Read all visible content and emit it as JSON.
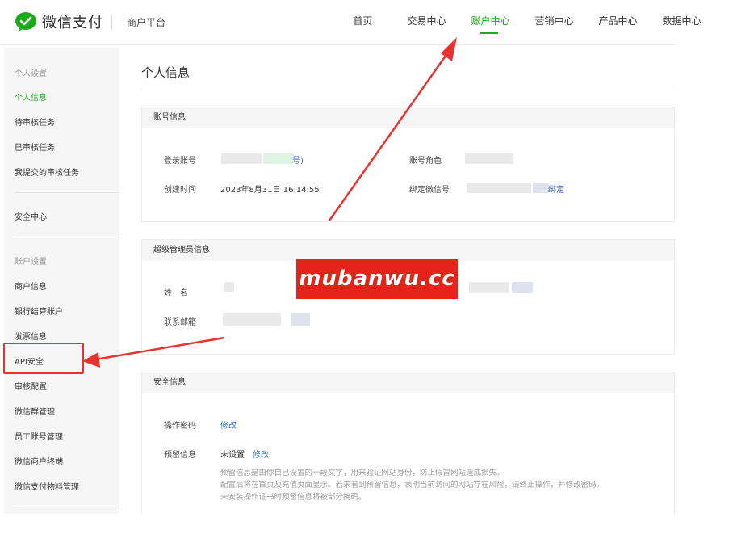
{
  "header": {
    "brand": "微信支付",
    "platform": "商户平台",
    "nav": [
      {
        "label": "首页"
      },
      {
        "label": "交易中心"
      },
      {
        "label": "账户中心",
        "active": true
      },
      {
        "label": "营销中心"
      },
      {
        "label": "产品中心"
      },
      {
        "label": "数据中心"
      }
    ]
  },
  "sidebar": {
    "group1_title": "个人设置",
    "group1_items": [
      {
        "label": "个人信息",
        "active": true
      },
      {
        "label": "待审核任务"
      },
      {
        "label": "已审核任务"
      },
      {
        "label": "我提交的审核任务"
      }
    ],
    "security_center": "安全中心",
    "group2_title": "账户设置",
    "group2_items": [
      {
        "label": "商户信息"
      },
      {
        "label": "银行结算账户"
      },
      {
        "label": "发票信息"
      },
      {
        "label": "API安全"
      },
      {
        "label": "审核配置"
      },
      {
        "label": "微信群管理"
      },
      {
        "label": "员工账号管理"
      },
      {
        "label": "微信商户终端"
      },
      {
        "label": "微信支付物料管理"
      }
    ]
  },
  "main": {
    "page_title": "个人信息",
    "account_panel": {
      "title": "账号信息",
      "login_label": "登录账号",
      "login_value_suffix": "号)",
      "role_label": "账号角色",
      "created_label": "创建时间",
      "created_value": "2023年8月31日 16:14:55",
      "wechat_label": "绑定微信号",
      "wechat_value_suffix": "绑定"
    },
    "admin_panel": {
      "title": "超级管理员信息",
      "name_label": "姓　名",
      "email_label": "联系邮箱"
    },
    "security_panel": {
      "title": "安全信息",
      "password_label": "操作密码",
      "password_action": "修改",
      "reserve_label": "预留信息",
      "reserve_value": "未设置",
      "reserve_action": "修改",
      "hint_lines": [
        "预留信息是由你自己设置的一段文字，用来验证网站身份，防止假冒网站造成损失。",
        "配置后将在首页及充值页面显示。若未看到预留信息，表明当前访问的网站存在风险，请终止操作，并修改密码。",
        "未安装操作证书时预留信息将被部分掩码。"
      ]
    }
  },
  "watermark": {
    "text": "mubanwu.cc"
  },
  "colors": {
    "brand_green": "#1aad19",
    "annotation_red": "#e8322f",
    "link_blue": "#3a6fc4"
  }
}
